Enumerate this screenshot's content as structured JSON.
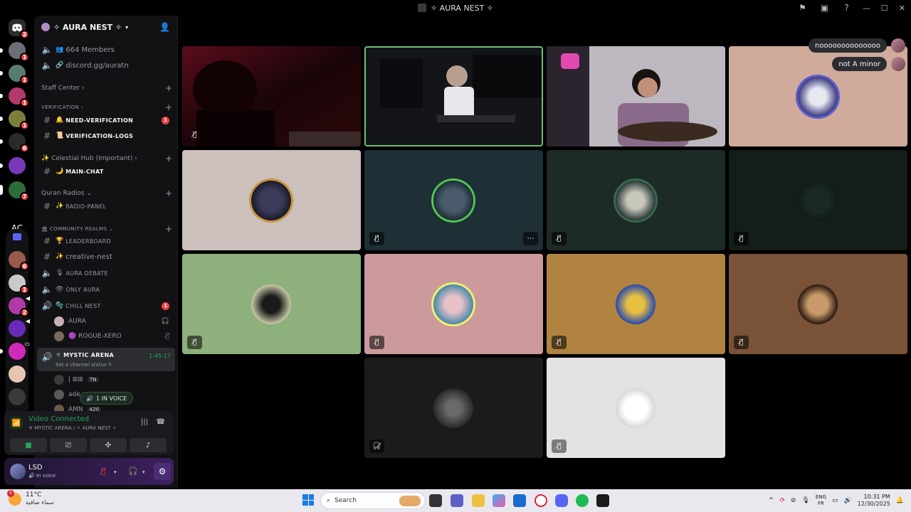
{
  "window": {
    "title": "✧ AURA NEST ✧"
  },
  "rail": {
    "servers": [
      {
        "name": "discord-home",
        "color": "#2b2d31",
        "badge": "2"
      },
      {
        "name": "server-1",
        "color": "#6d6f78",
        "badge": "1"
      },
      {
        "name": "server-2",
        "color": "#5a7b6f",
        "badge": "1"
      },
      {
        "name": "server-3",
        "color": "#b23a6a",
        "badge": "1"
      },
      {
        "name": "server-4",
        "color": "#7b7f3a",
        "badge": "1"
      },
      {
        "name": "server-5",
        "color": "#2a2a2a",
        "badge": "6"
      },
      {
        "name": "server-6",
        "color": "#7a3ab8",
        "badge": ""
      },
      {
        "name": "server-7",
        "color": "#2c6d3a",
        "badge": "7"
      }
    ],
    "ac_label": "AC",
    "folder_servers": [
      {
        "name": "folder-server-1",
        "color": "#9a5a4a",
        "badge": "6"
      },
      {
        "name": "folder-server-2",
        "color": "#c9c9c9",
        "badge": "1"
      },
      {
        "name": "folder-server-3",
        "color": "#b23aa8",
        "badge": "2"
      },
      {
        "name": "folder-server-4",
        "color": "#6a2ab8",
        "badge": ""
      },
      {
        "name": "folder-server-5",
        "color": "#d02ab8",
        "badge": ""
      },
      {
        "name": "folder-server-6",
        "color": "#e8c5b0",
        "badge": ""
      },
      {
        "name": "folder-server-7",
        "color": "#3a3a3a",
        "badge": ""
      }
    ]
  },
  "guild": {
    "name": "✧ AURA NEST ✧"
  },
  "channels": {
    "members": "664 Members",
    "invite": "discord.gg/auratn",
    "staff_center": "Staff Center",
    "verification_cat": "VERIFICATION",
    "need_verification": "NEED-VERIFICATION",
    "need_verification_badge": "1",
    "verification_logs": "VERIFICATION-LOGS",
    "celestial_cat": "Celestial Hub (Important)",
    "main_chat": "MAIN-CHAT",
    "quran_cat": "Quran Radios",
    "radio_panel": "RADIO-PANEL",
    "community_cat": "COMMUNITY REALMS",
    "leaderboard": "LEADERBOARD",
    "creative_nest": "creative-nest",
    "aura_debate": "AURA DEBATE",
    "only_aura": "ONLY AURA",
    "chill_nest": "CHILL NEST",
    "chill_nest_badge": "1",
    "member_aura": "AURA",
    "member_rogue": "ROGUE-XERO",
    "mystic_arena": "MYSTIC ARENA",
    "mystic_timer": "1:45:17",
    "set_status": "Set a channel status",
    "member_tn_prefix": "| ⊞⊞",
    "member_tn_tag": "TN",
    "member_ade": "ade",
    "member_amn": "AMN",
    "member_amn_tag": "420",
    "in_voice": "1 IN VOICE"
  },
  "voice": {
    "status": "Video Connected",
    "location": "MYSTIC ARENA / ✧ AURA NEST ✧"
  },
  "user": {
    "name": "LSD",
    "status": "In voice"
  },
  "chat_bubbles": [
    {
      "text": "noooooooooooooo"
    },
    {
      "text": "not A minor"
    }
  ],
  "tiles": [
    {
      "name": "tile-1",
      "bg": "#3a0a12",
      "muted": true
    },
    {
      "name": "tile-2",
      "bg": "#1c1d20",
      "muted": false
    },
    {
      "name": "tile-3",
      "bg": "#b8b2b8",
      "muted": false
    },
    {
      "name": "tile-4",
      "bg": "#d0aa9a",
      "muted": false
    },
    {
      "name": "tile-5",
      "bg": "#cbc0bc",
      "muted": false
    },
    {
      "name": "tile-6",
      "bg": "#1f2f36",
      "muted": true
    },
    {
      "name": "tile-7",
      "bg": "#1d2b26",
      "muted": true
    },
    {
      "name": "tile-8",
      "bg": "#151d18",
      "muted": true
    },
    {
      "name": "tile-9",
      "bg": "#8eb07c",
      "muted": true
    },
    {
      "name": "tile-10",
      "bg": "#cc9a9a",
      "muted": true
    },
    {
      "name": "tile-11",
      "bg": "#b08440",
      "muted": true
    },
    {
      "name": "tile-12",
      "bg": "#7a5238",
      "muted": true
    },
    {
      "name": "tile-13",
      "bg": "#1b1b1b",
      "muted": true
    },
    {
      "name": "tile-14",
      "bg": "#e3e3e3",
      "muted": true
    }
  ],
  "taskbar": {
    "weather_badge": "5",
    "temperature": "11°C",
    "weather_desc": "سماء صافية",
    "search_placeholder": "Search",
    "lang_1": "ENG",
    "lang_2": "FR",
    "time": "10:31 PM",
    "date": "12/30/2025"
  }
}
